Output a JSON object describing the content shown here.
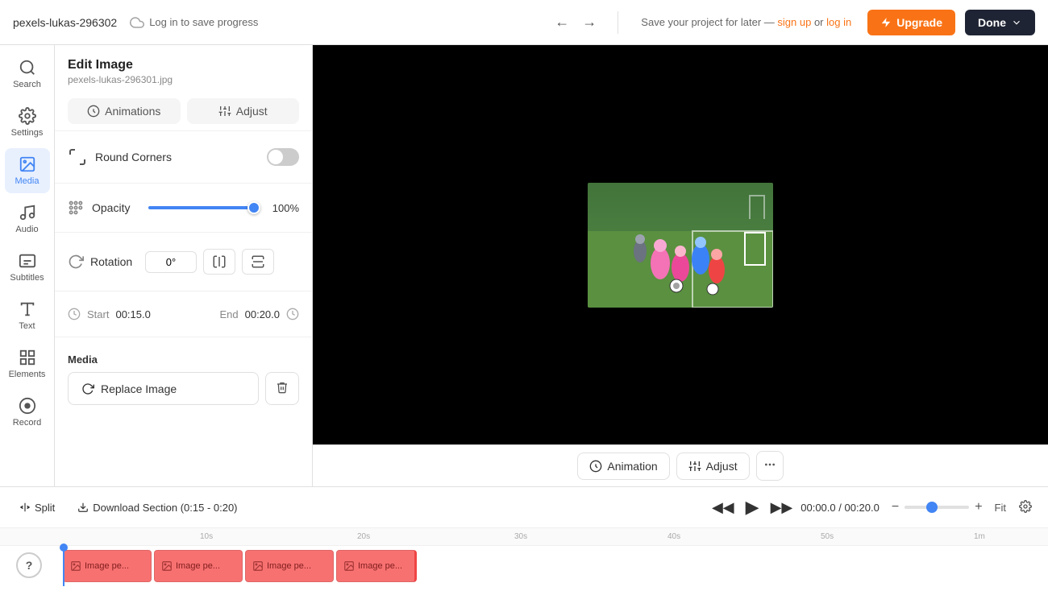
{
  "topbar": {
    "filename": "pexels-lukas-296302",
    "original_filename": "pexels-lukas-296301.jpg",
    "save_label": "Log in to save progress",
    "save_msg": "Save your project for later —",
    "sign_up": "sign up",
    "or": "or",
    "log_in": "log in",
    "upgrade_label": "Upgrade",
    "done_label": "Done"
  },
  "sidebar": {
    "items": [
      {
        "id": "search",
        "label": "Search",
        "active": false
      },
      {
        "id": "settings",
        "label": "Settings",
        "active": false
      },
      {
        "id": "media",
        "label": "Media",
        "active": true
      },
      {
        "id": "audio",
        "label": "Audio",
        "active": false
      },
      {
        "id": "subtitles",
        "label": "Subtitles",
        "active": false
      },
      {
        "id": "text",
        "label": "Text",
        "active": false
      },
      {
        "id": "elements",
        "label": "Elements",
        "active": false
      },
      {
        "id": "record",
        "label": "Record",
        "active": false
      }
    ]
  },
  "panel": {
    "title": "Edit Image",
    "subtitle": "pexels-lukas-296301.jpg",
    "tabs": [
      {
        "id": "animations",
        "label": "Animations"
      },
      {
        "id": "adjust",
        "label": "Adjust"
      }
    ],
    "round_corners": {
      "label": "Round Corners",
      "enabled": false
    },
    "opacity": {
      "label": "Opacity",
      "value": 100,
      "display": "100%"
    },
    "rotation": {
      "label": "Rotation",
      "value": "0°",
      "flip_h_title": "Flip horizontal",
      "flip_v_title": "Flip vertical"
    },
    "timing": {
      "start_label": "Start",
      "start_value": "00:15.0",
      "end_label": "End",
      "end_value": "00:20.0"
    },
    "media": {
      "label": "Media",
      "replace_label": "Replace Image"
    }
  },
  "canvas": {
    "bottom_tools": [
      {
        "id": "animation",
        "label": "Animation",
        "icon": "animation-icon"
      },
      {
        "id": "adjust",
        "label": "Adjust",
        "icon": "adjust-icon"
      },
      {
        "id": "more",
        "label": "...",
        "icon": "more-icon"
      }
    ]
  },
  "timeline": {
    "split_label": "Split",
    "download_label": "Download Section (0:15 - 0:20)",
    "current_time": "00:00.0",
    "total_time": "00:20.0",
    "fit_label": "Fit",
    "ruler_marks": [
      "10s",
      "20s",
      "30s",
      "40s",
      "50s",
      "1m"
    ],
    "clips": [
      {
        "id": 1,
        "label": "Image pe..."
      },
      {
        "id": 2,
        "label": "Image pe..."
      },
      {
        "id": 3,
        "label": "Image pe..."
      },
      {
        "id": 4,
        "label": "Image pe..."
      }
    ]
  },
  "help": {
    "label": "?"
  }
}
